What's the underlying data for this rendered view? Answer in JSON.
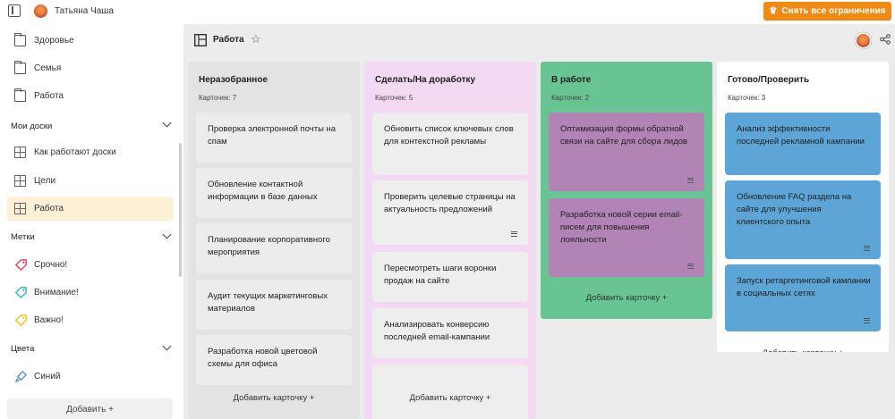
{
  "topbar": {
    "username": "Татьяна Чаша",
    "upgrade_label": "Снять все ограничения"
  },
  "sidebar": {
    "folders": [
      {
        "label": "Здоровье",
        "icon": "folder-icon"
      },
      {
        "label": "Семья",
        "icon": "folder-icon"
      },
      {
        "label": "Работа",
        "icon": "folder-icon"
      }
    ],
    "boards_section": "Мои доски",
    "boards": [
      {
        "label": "Как работают доски",
        "icon": "board-icon"
      },
      {
        "label": "Цели",
        "icon": "board-icon"
      },
      {
        "label": "Работа",
        "icon": "board-icon",
        "active": true
      }
    ],
    "tags_section": "Метки",
    "tags": [
      {
        "label": "Срочно!",
        "color": "#e8455a"
      },
      {
        "label": "Внимание!",
        "color": "#35b7c4"
      },
      {
        "label": "Важно!",
        "color": "#f1c021"
      }
    ],
    "colors_section": "Цвета",
    "colors": [
      {
        "label": "Синий",
        "icon": "brush-icon",
        "color": "#4a8fd6"
      }
    ],
    "add_label": "Добавить +"
  },
  "board": {
    "title": "Работа",
    "columns": [
      {
        "title": "Неразобранное",
        "count": "Карточек: 7",
        "bg": "#e3e3e3",
        "card_bg": "#ececec",
        "add_label": "Добавить карточку +",
        "cards": [
          {
            "text": "Проверка электронной почты на спам"
          },
          {
            "text": "Обновление контактной информации в базе данных"
          },
          {
            "text": "Планирование корпоративного мероприятия"
          },
          {
            "text": "Аудит текущих маркетинговых материалов"
          },
          {
            "text": "Разработка новой цветовой схемы для офиса"
          }
        ]
      },
      {
        "title": "Сделать/На доработку",
        "count": "Карточек: 5",
        "bg": "#f3d9f2",
        "card_bg": "#eeeeee",
        "add_label": "Добавить карточку +",
        "cards": [
          {
            "text": "Обновить список ключевых слов для контекстной рекламы"
          },
          {
            "text": "Проверить целевые страницы на актуальность предложений",
            "desc": true
          },
          {
            "text": "Пересмотреть шаги воронки продаж на сайте"
          },
          {
            "text": "Анализировать конверсию последней email-кампании"
          },
          {
            "text": ""
          }
        ]
      },
      {
        "title": "В работе",
        "count": "Карточек: 2",
        "bg": "#68c593",
        "card_bg": "#b284b5",
        "add_label": "Добавить карточку +",
        "cards": [
          {
            "text": "Оптимизация формы обратной связи на сайте для сбора лидов",
            "desc": true
          },
          {
            "text": "Разработка новой серии email-писем для повышения лояльности",
            "desc": true
          }
        ]
      },
      {
        "title": "Готово/Проверить",
        "count": "Карточек: 3",
        "bg": "#ffffff",
        "card_bg": "#5ca5d6",
        "add_label": "Добавить карточку +",
        "cards": [
          {
            "text": "Анализ эффективности последней рекламной кампании"
          },
          {
            "text": "Обновление FAQ раздела на сайте для улучшения клиентского опыта",
            "desc": true
          },
          {
            "text": "Запуск ретаргетинговой кампании в социальных сетях",
            "desc": true
          }
        ]
      }
    ]
  }
}
